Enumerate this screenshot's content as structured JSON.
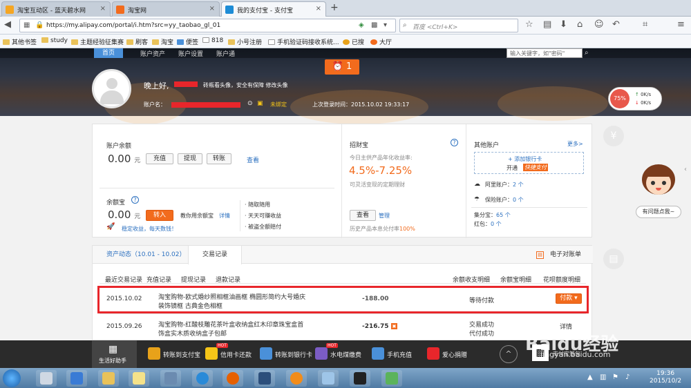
{
  "tabs": [
    {
      "label": "淘宝互动区 - 蓝天碧水网",
      "active": false
    },
    {
      "label": "淘宝网",
      "active": false
    },
    {
      "label": "我的支付宝 - 支付宝",
      "active": true
    }
  ],
  "nav": {
    "url": "https://my.alipay.com/portal/i.htm?src=yy_taobao_gl_01",
    "search_placeholder": "百度 <Ctrl+K>"
  },
  "bookmarks": [
    "其他书签",
    "study",
    "主题经验征集赛",
    "刷客",
    "淘宝",
    "便签",
    "818",
    "小号注册",
    "手机验证码接收系统...",
    "已搜",
    "大厅"
  ],
  "menu": {
    "items": [
      "首页",
      "账户资产",
      "账户设置",
      "账户通"
    ],
    "search_placeholder": "输入关键字，如\"密码\""
  },
  "hero": {
    "alarm_count": "1",
    "greeting": "晚上好,",
    "avatar_tip": "砖瓶看头像，安全有保障 修改头像",
    "account_label": "账户名：",
    "unbound": "未绑定",
    "last_login": "上次登录时间：2015.10.02 19:33:17",
    "speed_percent": "75%",
    "speed_up": "0K/s",
    "speed_down": "0K/s"
  },
  "balance": {
    "title": "账户余额",
    "amount": "0.00",
    "unit": "元",
    "btn_recharge": "充值",
    "btn_withdraw": "提现",
    "btn_transfer": "转账",
    "view": "查看"
  },
  "yuebao": {
    "title": "余额宝",
    "amount": "0.00",
    "unit": "元",
    "btn_in": "转入",
    "teach": "教你用余额宝",
    "detail": "详情",
    "promo": "稳定收益，每天数钱！",
    "features": [
      "随取随用",
      "天天可赚收益",
      "被盗全额赔付"
    ]
  },
  "zhaocaibao": {
    "title": "招财宝",
    "desc": "今日主供产品年化收益率:",
    "rate": "4.5%-7.25%",
    "sub": "可灵活变现的定期理财",
    "btn_view": "查看",
    "manage": "管理",
    "history": "历史产品本息兑付率",
    "history_rate": "100%"
  },
  "other": {
    "title": "其他账户",
    "more": "更多>",
    "add_card": "+ 添加银行卡",
    "open": "开通",
    "quick": "快捷支付",
    "ali_account": "阿里账户：",
    "ali_count": "2 个",
    "insurance": "保险账户：",
    "ins_count": "0 个",
    "jifen": "集分宝：",
    "jifen_val": "65 个",
    "hongbao": "红包：",
    "hongbao_val": "0 个"
  },
  "records": {
    "tab_assets": "资产动态（10.01 - 10.02）",
    "tab_records": "交易记录",
    "e_bill": "电子对账单",
    "recent": "最近交易记录",
    "links": [
      "充值记录",
      "提现记录",
      "退款记录"
    ],
    "right_links": [
      "余额收支明细",
      "余额宝明细",
      "花呗额度明细"
    ],
    "rows": [
      {
        "date": "2015.10.02",
        "desc1": "淘宝购物-欧式婚纱照相框油画框 椭圆形简约大号婚庆",
        "desc2": "装饰镜框 古典金色相框",
        "amount": "-188.00",
        "status": "等待付款",
        "action": "付款"
      },
      {
        "date": "2015.09.26",
        "desc1": "淘宝购物-红酸枝雕花茶叶盒收纳盒红木印章珠宝盒首",
        "desc2": "饰盒实木质收纳盒子包邮",
        "amount": "-216.75",
        "status": "交易成功",
        "status2": "代付成功",
        "action": "详情"
      }
    ]
  },
  "side": {
    "help": "有问题点我~"
  },
  "bottom": {
    "assistant": "生活好助手",
    "items": [
      "转账到支付宝",
      "信用卡还款",
      "转账到银行卡",
      "水电煤缴费",
      "手机充值",
      "爱心捐赠"
    ],
    "hot": "HOT",
    "scan": "支付宝钱包"
  },
  "taskbar": {
    "time": "19:36",
    "date": "2015/10/2"
  },
  "watermark": {
    "main": "Baidu经验",
    "sub": "jingyan.baidu.com"
  }
}
